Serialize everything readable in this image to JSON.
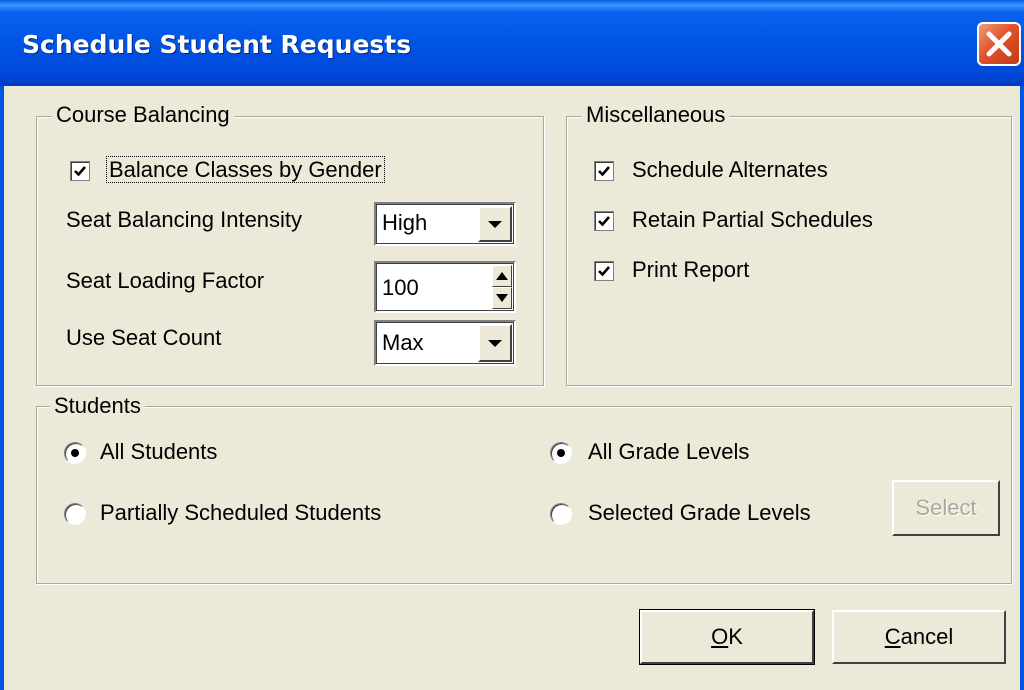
{
  "window": {
    "title": "Schedule Student Requests"
  },
  "course_balancing": {
    "legend": "Course Balancing",
    "balance_by_gender": {
      "label": "Balance Classes by Gender",
      "checked": true
    },
    "seat_balancing_intensity": {
      "label": "Seat Balancing Intensity",
      "value": "High"
    },
    "seat_loading_factor": {
      "label": "Seat Loading Factor",
      "value": "100"
    },
    "use_seat_count": {
      "label": "Use Seat Count",
      "value": "Max"
    }
  },
  "miscellaneous": {
    "legend": "Miscellaneous",
    "schedule_alternates": {
      "label": "Schedule Alternates",
      "checked": true
    },
    "retain_partial": {
      "label": "Retain Partial Schedules",
      "checked": true
    },
    "print_report": {
      "label": "Print Report",
      "checked": true
    }
  },
  "students": {
    "legend": "Students",
    "all_students": {
      "label": "All Students",
      "selected": true
    },
    "partially_scheduled": {
      "label": "Partially Scheduled Students",
      "selected": false
    },
    "all_grade_levels": {
      "label": "All Grade Levels",
      "selected": true
    },
    "selected_grade_levels": {
      "label": "Selected Grade Levels",
      "selected": false
    },
    "select_button": "Select"
  },
  "buttons": {
    "ok": {
      "mnemonic": "O",
      "rest": "K"
    },
    "cancel": {
      "mnemonic": "C",
      "rest": "ancel"
    }
  },
  "colors": {
    "titlebar": "#0055e5",
    "dialog_bg": "#ece9d8",
    "close_button": "#e0542c",
    "disabled_text": "#aca899"
  }
}
